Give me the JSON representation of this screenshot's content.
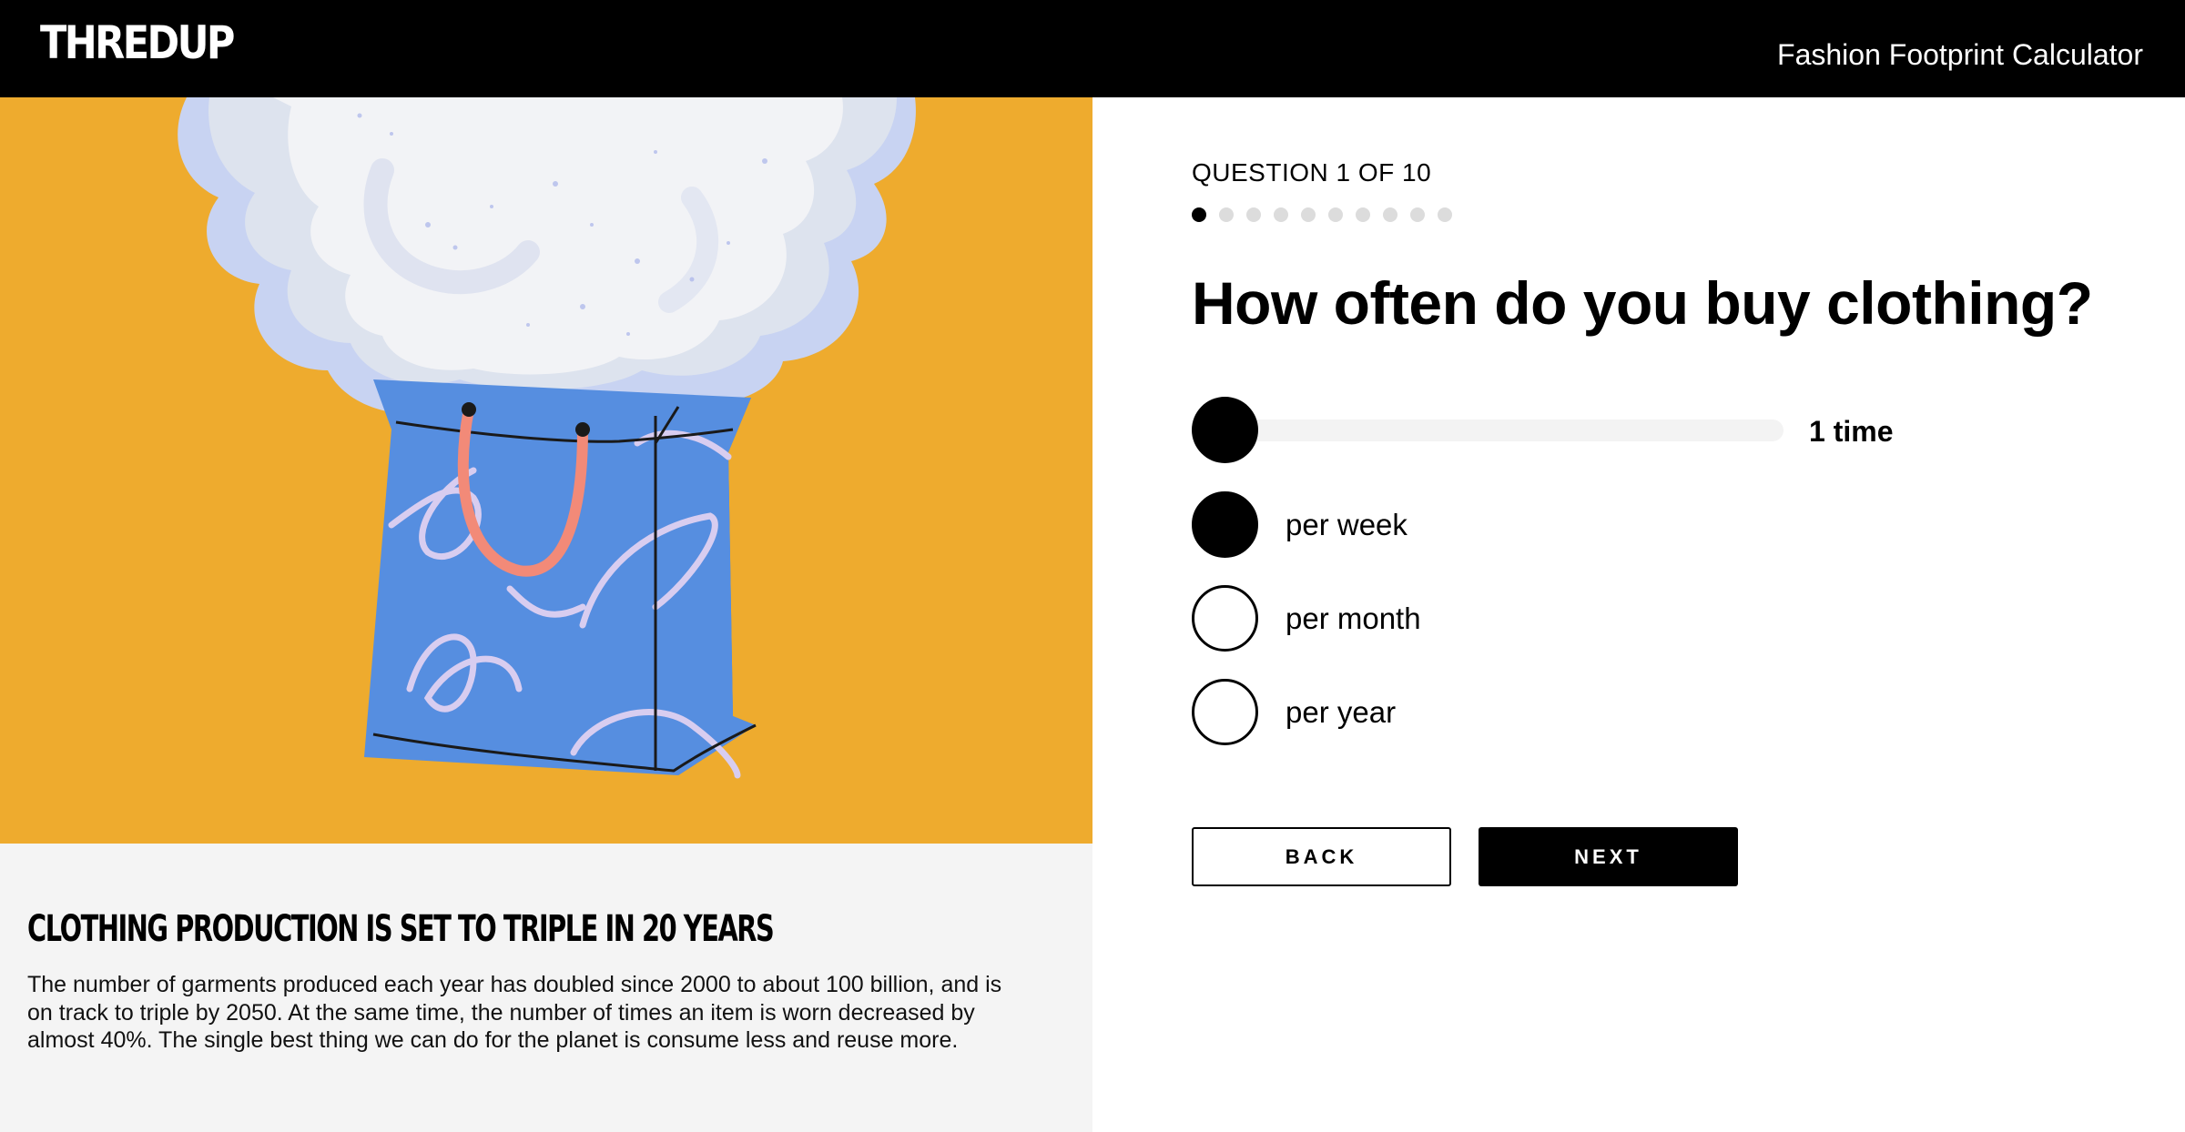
{
  "header": {
    "logo_text": "THREDUP",
    "title": "Fashion Footprint Calculator"
  },
  "progress": {
    "label": "QUESTION 1 OF 10",
    "current": 1,
    "total": 10
  },
  "question": {
    "text": "How often do you buy clothing?",
    "slider_value_label": "1 time",
    "slider_fraction": 0.0,
    "options": [
      {
        "label": "per week",
        "selected": true
      },
      {
        "label": "per month",
        "selected": false
      },
      {
        "label": "per year",
        "selected": false
      }
    ]
  },
  "buttons": {
    "back_label": "BACK",
    "next_label": "NEXT"
  },
  "fact": {
    "heading": "CLOTHING PRODUCTION IS SET TO TRIPLE IN 20 YEARS",
    "text": "The number of garments produced each year has doubled since 2000 to about 100 billion, and is on track to triple by 2050. At the same time, the number of times an item is worn decreased by almost 40%. The single best thing we can do for the planet is consume less and reuse more."
  },
  "colors": {
    "illustration_bg": "#eeab2e",
    "bag": "#568ee0",
    "handle": "#f28a78",
    "cloud": "#f2f3f6",
    "cloud_shadow": "#c8d3f2"
  },
  "icons": {
    "illustration": "shopping-bag-with-cloud-illustration"
  }
}
